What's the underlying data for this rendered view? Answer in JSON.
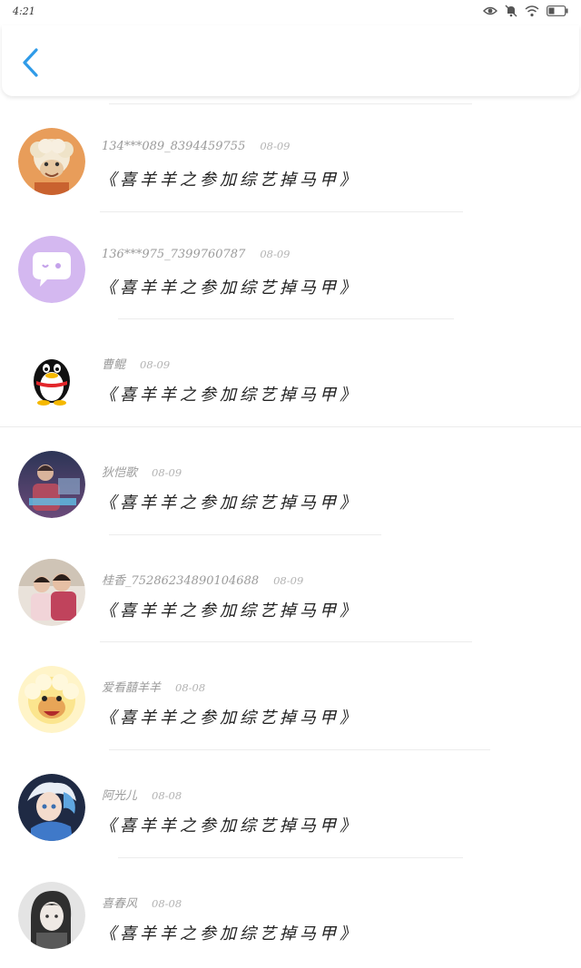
{
  "status_bar": {
    "time": "4:21",
    "icons": [
      "eye-icon",
      "bell-muted-icon",
      "wifi-icon",
      "battery-icon"
    ]
  },
  "header": {
    "back_icon": "chevron-left-icon",
    "accent_color": "#2f9be8"
  },
  "comments": [
    {
      "user": "134***089_8394459755",
      "date": "08-09",
      "text": "《喜羊羊之参加综艺掉马甲》",
      "avatar": "cartoon-sheep"
    },
    {
      "user": "136***975_7399760787",
      "date": "08-09",
      "text": "《喜羊羊之参加综艺掉马甲》",
      "avatar": "chat-bubble"
    },
    {
      "user": "曹鲲",
      "date": "08-09",
      "text": "《喜羊羊之参加综艺掉马甲》",
      "avatar": "qq-penguin"
    },
    {
      "user": "狄恺歌",
      "date": "08-09",
      "text": "《喜羊羊之参加综艺掉马甲》",
      "avatar": "photo-person"
    },
    {
      "user": "桂香_75286234890104688",
      "date": "08-09",
      "text": "《喜羊羊之参加综艺掉马甲》",
      "avatar": "photo-kids"
    },
    {
      "user": "爱看囍羊羊",
      "date": "08-08",
      "text": "《喜羊羊之参加综艺掉马甲》",
      "avatar": "cartoon-sheep-yellow"
    },
    {
      "user": "阿光儿",
      "date": "08-08",
      "text": "《喜羊羊之参加综艺掉马甲》",
      "avatar": "anime-boy"
    },
    {
      "user": "喜春风",
      "date": "08-08",
      "text": "《喜羊羊之参加综艺掉马甲》",
      "avatar": "photo-girl"
    }
  ]
}
